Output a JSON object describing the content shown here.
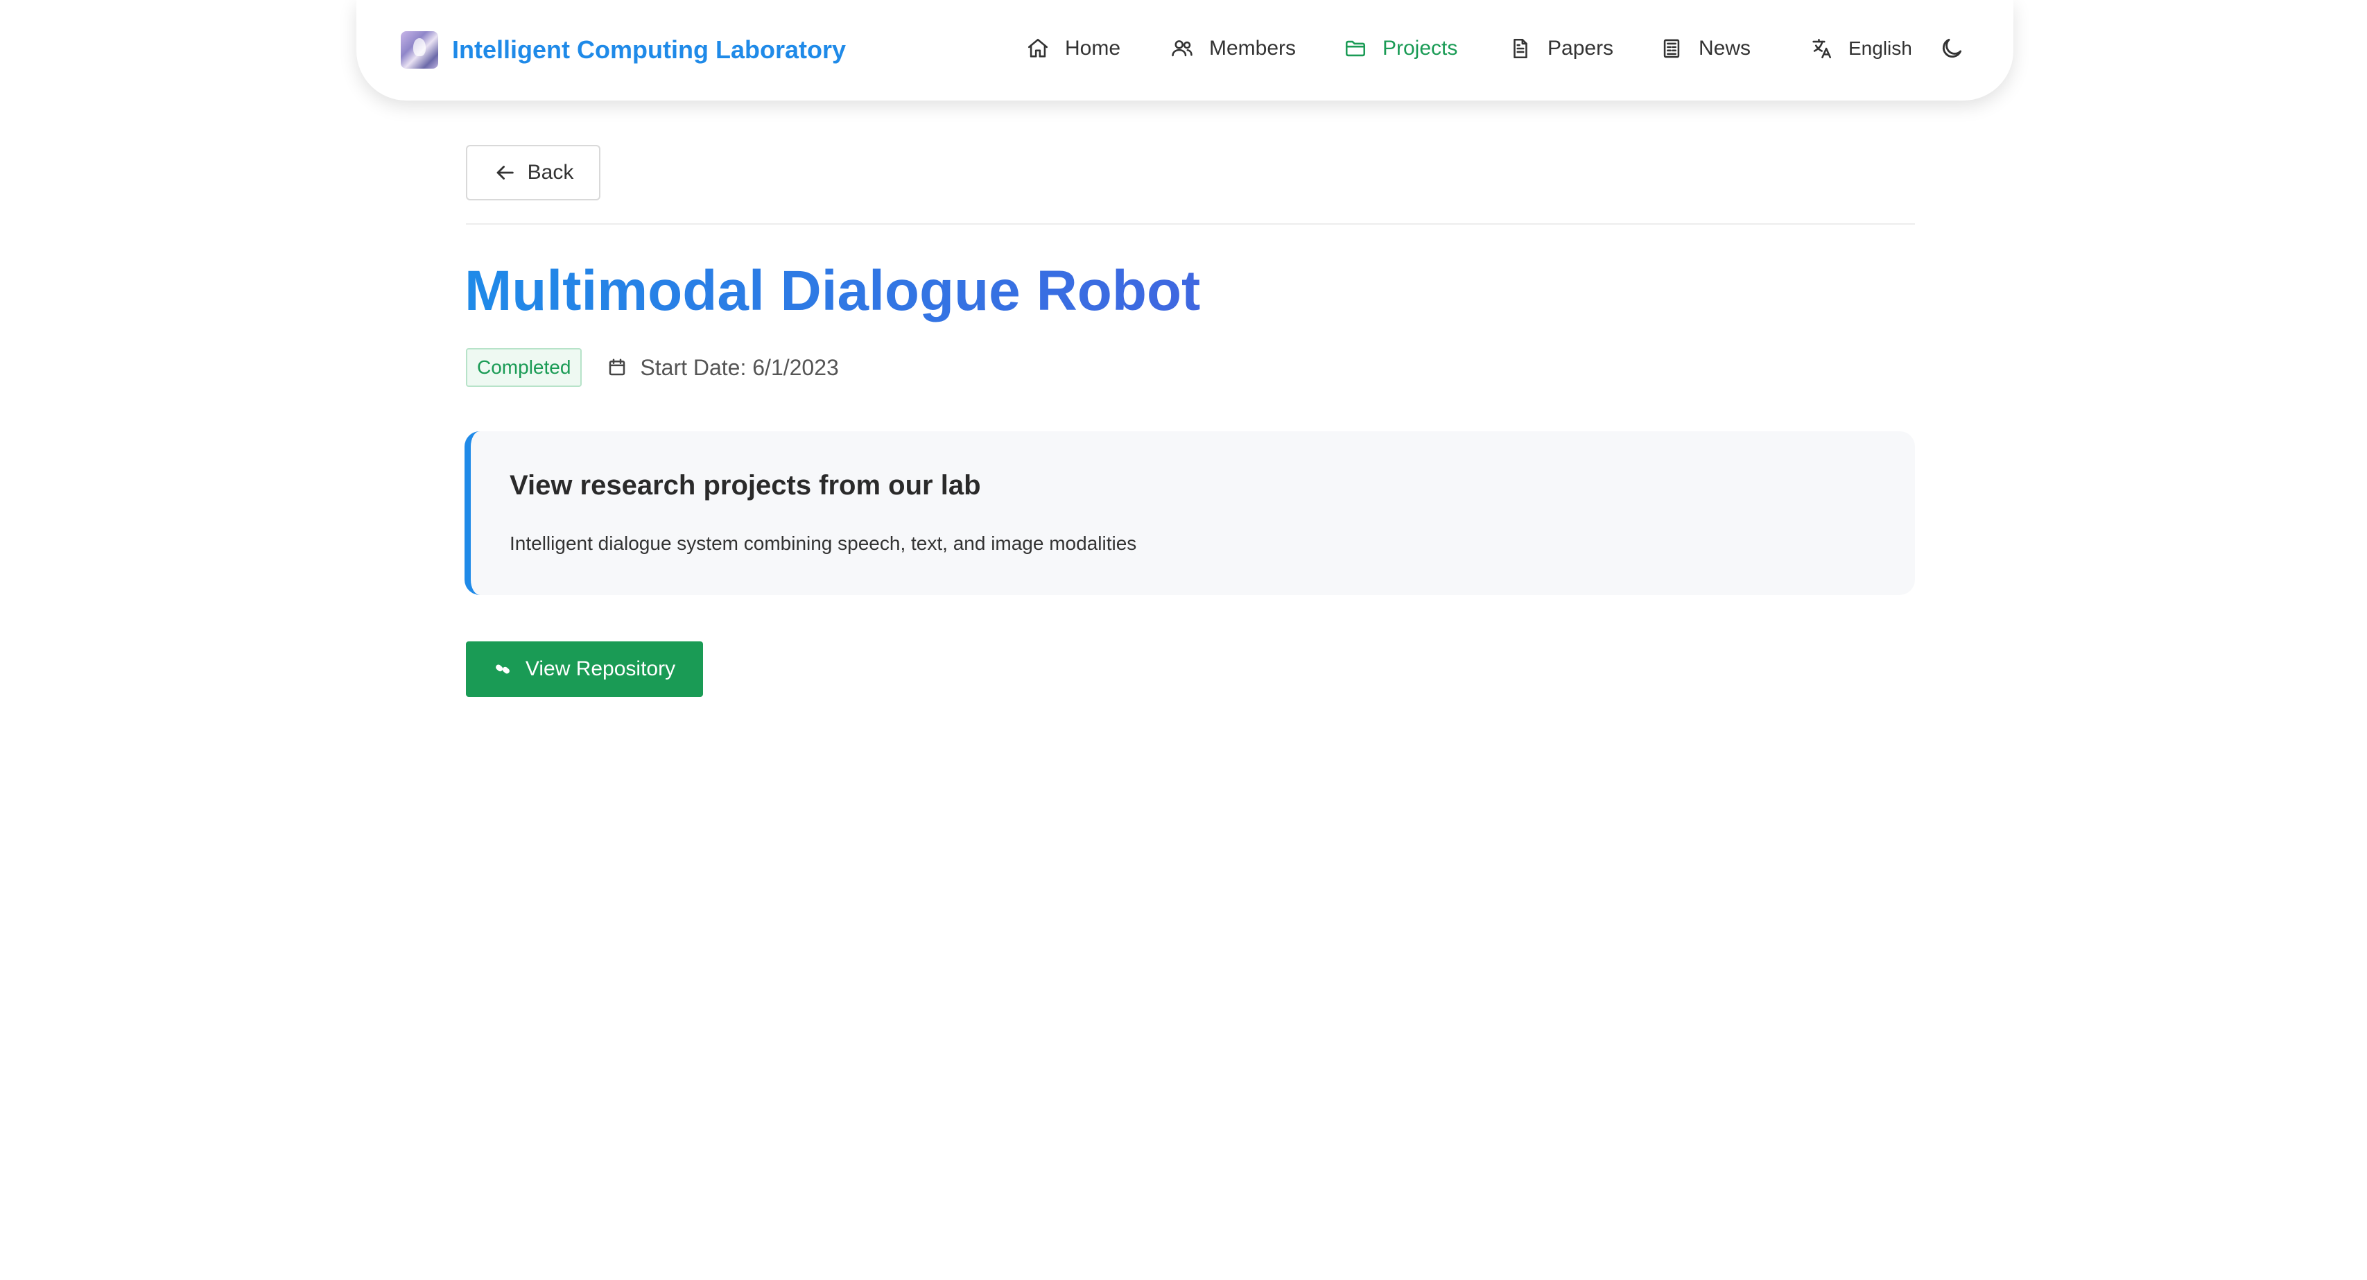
{
  "header": {
    "brand_title": "Intelligent Computing Laboratory",
    "nav": [
      {
        "label": "Home",
        "icon": "home-icon",
        "active": false
      },
      {
        "label": "Members",
        "icon": "users-icon",
        "active": false
      },
      {
        "label": "Projects",
        "icon": "folder-icon",
        "active": true
      },
      {
        "label": "Papers",
        "icon": "document-icon",
        "active": false
      },
      {
        "label": "News",
        "icon": "newspaper-icon",
        "active": false
      }
    ],
    "language": {
      "label": "English",
      "icon": "translate-icon"
    },
    "theme_toggle_icon": "moon-icon"
  },
  "main": {
    "back_label": "Back",
    "title": "Multimodal Dialogue Robot",
    "status": "Completed",
    "start_date": "Start Date: 6/1/2023",
    "card": {
      "heading": "View research projects from our lab",
      "description": "Intelligent dialogue system combining speech, text, and image modalities"
    },
    "repo_button_label": "View Repository"
  },
  "colors": {
    "brand": "#1f8ae8",
    "accent_green": "#1a9b55",
    "title_gradient_end": "#3f67e0"
  }
}
